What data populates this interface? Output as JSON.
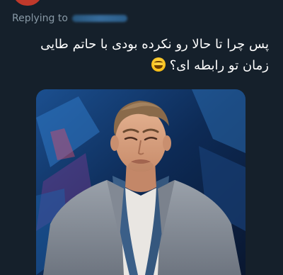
{
  "reply": {
    "label": "Replying to"
  },
  "tweet": {
    "line1": "پس چرا تا حالا رو نکرده بودی با حاتم طایی",
    "line2": "زمان تو رابطه ای؟",
    "emoji_icon": "grinning-squinting-face-icon"
  },
  "colors": {
    "background": "#15202b",
    "text": "#ffffff",
    "muted": "#8899a6"
  }
}
